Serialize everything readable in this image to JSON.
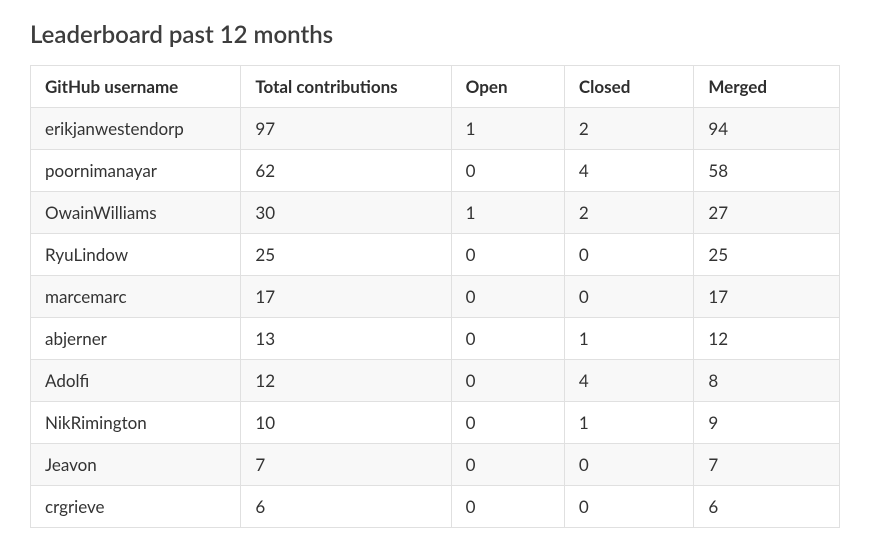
{
  "title": "Leaderboard past 12 months",
  "columns": [
    "GitHub username",
    "Total contributions",
    "Open",
    "Closed",
    "Merged"
  ],
  "rows": [
    {
      "username": "erikjanwestendorp",
      "total": 97,
      "open": 1,
      "closed": 2,
      "merged": 94
    },
    {
      "username": "poornimanayar",
      "total": 62,
      "open": 0,
      "closed": 4,
      "merged": 58
    },
    {
      "username": "OwainWilliams",
      "total": 30,
      "open": 1,
      "closed": 2,
      "merged": 27
    },
    {
      "username": "RyuLindow",
      "total": 25,
      "open": 0,
      "closed": 0,
      "merged": 25
    },
    {
      "username": "marcemarc",
      "total": 17,
      "open": 0,
      "closed": 0,
      "merged": 17
    },
    {
      "username": "abjerner",
      "total": 13,
      "open": 0,
      "closed": 1,
      "merged": 12
    },
    {
      "username": "Adolfi",
      "total": 12,
      "open": 0,
      "closed": 4,
      "merged": 8
    },
    {
      "username": "NikRimington",
      "total": 10,
      "open": 0,
      "closed": 1,
      "merged": 9
    },
    {
      "username": "Jeavon",
      "total": 7,
      "open": 0,
      "closed": 0,
      "merged": 7
    },
    {
      "username": "crgrieve",
      "total": 6,
      "open": 0,
      "closed": 0,
      "merged": 6
    }
  ]
}
